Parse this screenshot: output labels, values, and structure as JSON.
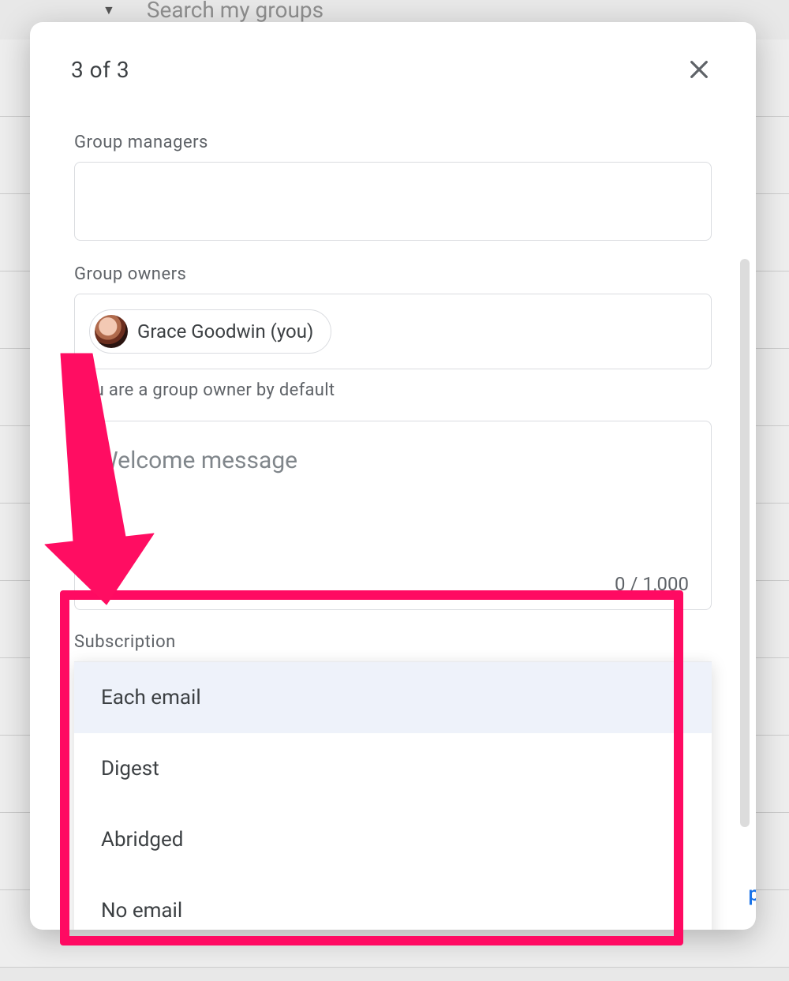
{
  "background": {
    "search_placeholder": "Search my groups"
  },
  "modal": {
    "step_indicator": "3 of 3",
    "managers_label": "Group managers",
    "owners_label": "Group owners",
    "owner_chip": "Grace Goodwin (you)",
    "owner_hint": "You are a group owner by default",
    "welcome_placeholder": "Welcome message",
    "char_count": "0 / 1,000",
    "blue_peek": "p"
  },
  "subscription": {
    "label": "Subscription",
    "options": [
      "Each email",
      "Digest",
      "Abridged",
      "No email"
    ],
    "selected_index": 0
  }
}
